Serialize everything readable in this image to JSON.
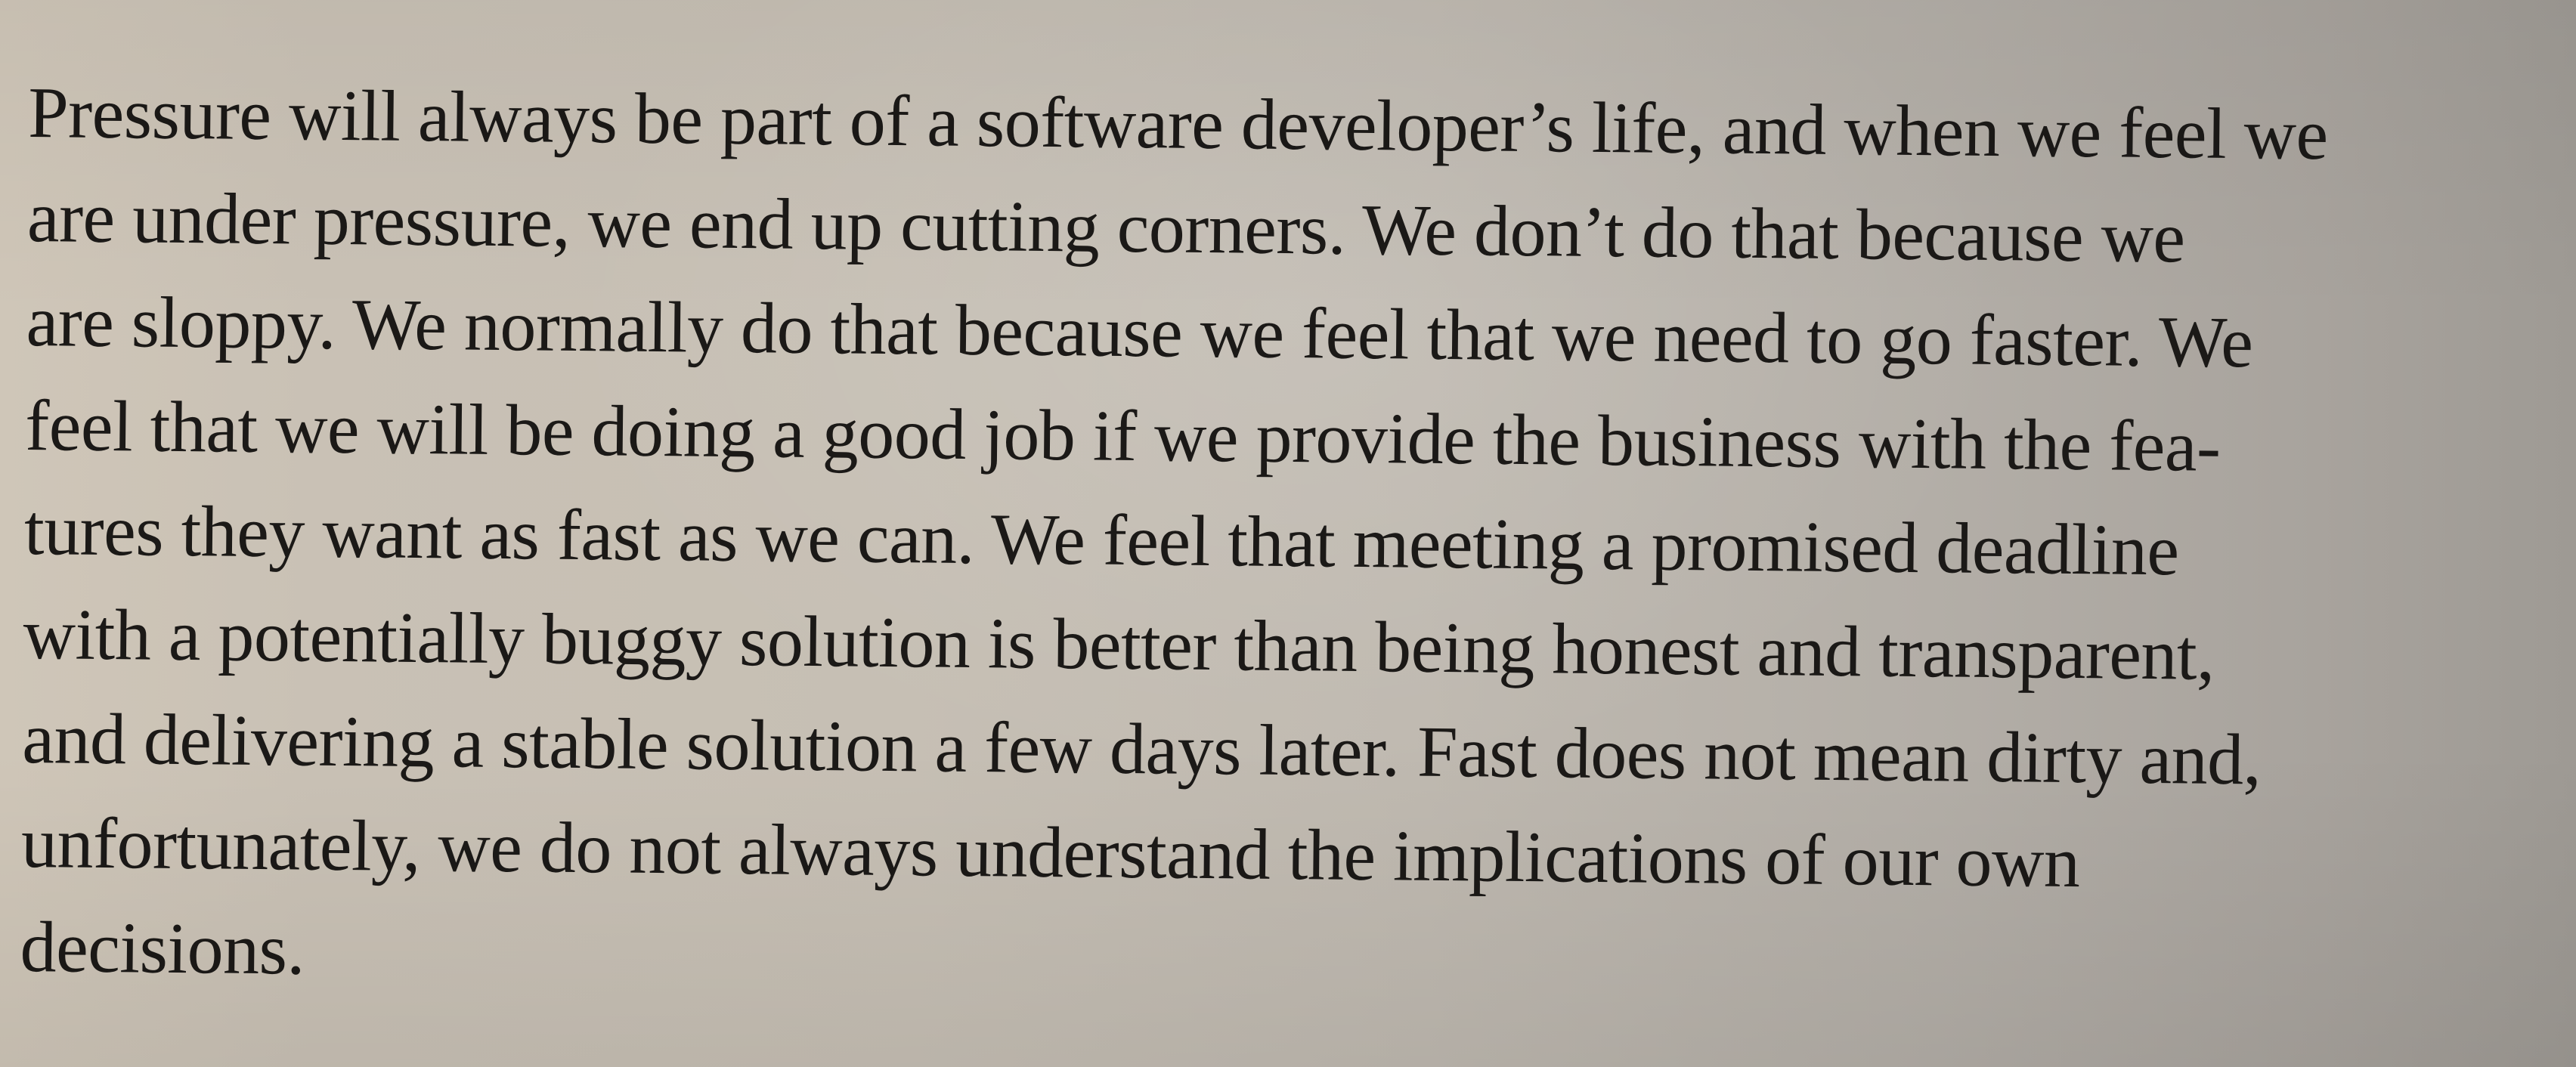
{
  "document": {
    "lines": [
      "Pressure will always be part of a software developer’s life, and when we feel we",
      "are under pressure, we end up cutting corners. We don’t do that because we",
      "are sloppy. We normally do that because we feel that we need to go faster. We",
      "feel that we will be doing a good job if we provide the business with the fea-",
      "tures they want as fast as we can. We feel that meeting a promised deadline",
      "with a potentially buggy solution is better than being honest and transparent,",
      "and delivering a stable solution a few days later. Fast does not mean dirty and,",
      "unfortunately, we do not always understand the implications of our own",
      "decisions."
    ]
  }
}
